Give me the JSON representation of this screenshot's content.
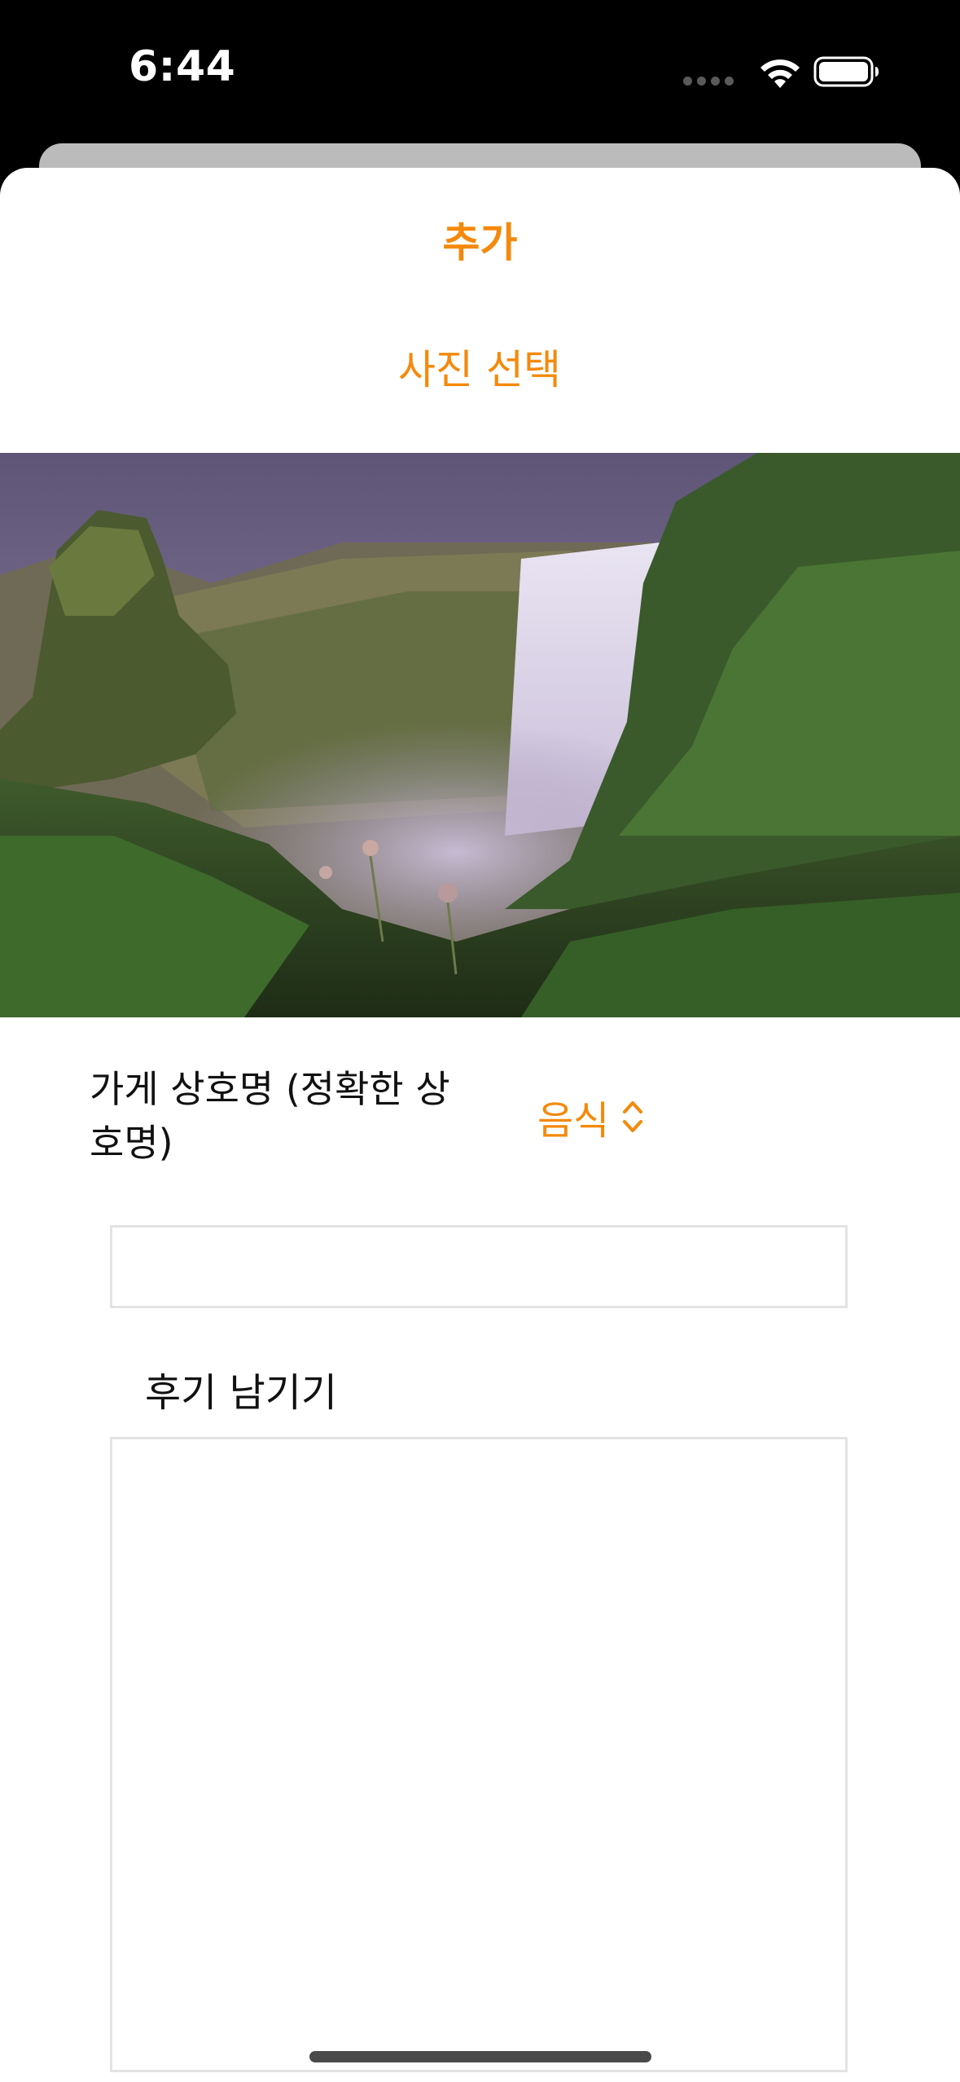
{
  "status_bar": {
    "time": "6:44",
    "icons": [
      "cellular-dots-icon",
      "wifi-icon",
      "battery-icon"
    ]
  },
  "sheet": {
    "title": "추가",
    "select_photo_label": "사진 선택"
  },
  "form": {
    "store_name_label": "가게 상호명 (정확한 상호명)",
    "category_value": "음식",
    "store_name_value": "",
    "review_label": "후기 남기기",
    "review_value": ""
  },
  "colors": {
    "accent": "#f5890b",
    "border": "#e3e3e3"
  }
}
